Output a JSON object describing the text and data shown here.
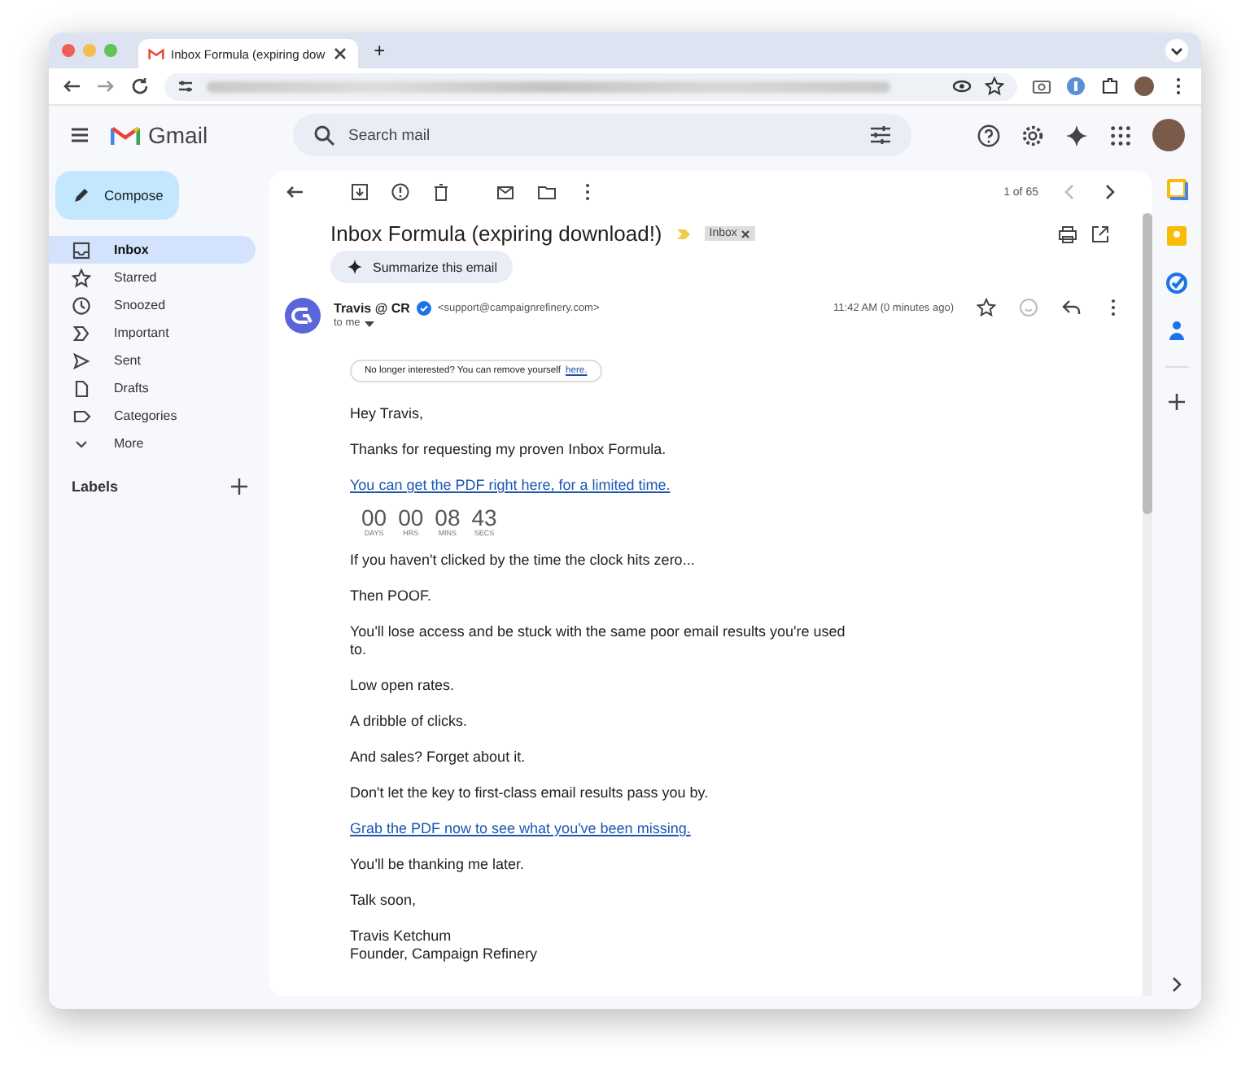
{
  "browser": {
    "tab_title": "Inbox Formula (expiring dow",
    "new_tab": "+"
  },
  "app": {
    "name": "Gmail",
    "search_placeholder": "Search mail"
  },
  "compose": "Compose",
  "nav": [
    {
      "label": "Inbox",
      "selected": true
    },
    {
      "label": "Starred",
      "selected": false
    },
    {
      "label": "Snoozed",
      "selected": false
    },
    {
      "label": "Important",
      "selected": false
    },
    {
      "label": "Sent",
      "selected": false
    },
    {
      "label": "Drafts",
      "selected": false
    },
    {
      "label": "Categories",
      "selected": false
    },
    {
      "label": "More",
      "selected": false
    }
  ],
  "labels_heading": "Labels",
  "pager": "1 of 65",
  "email": {
    "subject": "Inbox Formula (expiring download!)",
    "label_chip": "Inbox",
    "summarize": "Summarize this email",
    "sender": "Travis @ CR",
    "sender_email": "<support@campaignrefinery.com>",
    "to": "to me",
    "time": "11:42 AM (0 minutes ago)",
    "unsubscribe_text": "No longer interested? You can remove yourself",
    "unsubscribe_link": "here.",
    "body": [
      {
        "kind": "text",
        "text": "Hey Travis,"
      },
      {
        "kind": "text",
        "text": "Thanks for requesting my proven Inbox Formula."
      },
      {
        "kind": "link",
        "text": "You can get the PDF right here, for a limited time."
      },
      {
        "kind": "countdown",
        "units": [
          {
            "value": "00",
            "unit": "DAYS"
          },
          {
            "value": "00",
            "unit": "HRS"
          },
          {
            "value": "08",
            "unit": "MINS"
          },
          {
            "value": "43",
            "unit": "SECS"
          }
        ]
      },
      {
        "kind": "text",
        "text": "If you haven't clicked by the time the clock hits zero..."
      },
      {
        "kind": "text",
        "text": "Then POOF."
      },
      {
        "kind": "text",
        "text": "You'll lose access and be stuck with the same poor email results you're used to."
      },
      {
        "kind": "text",
        "text": "Low open rates."
      },
      {
        "kind": "text",
        "text": "A dribble of clicks."
      },
      {
        "kind": "text",
        "text": "And sales? Forget about it."
      },
      {
        "kind": "text",
        "text": "Don't let the key to first-class email results pass you by."
      },
      {
        "kind": "link",
        "text": "Grab the PDF now to see what you've been missing."
      },
      {
        "kind": "text",
        "text": "You'll be thanking me later."
      },
      {
        "kind": "text",
        "text": "Talk soon,"
      },
      {
        "kind": "signature",
        "lines": [
          "Travis Ketchum",
          "Founder, Campaign Refinery"
        ]
      }
    ]
  }
}
